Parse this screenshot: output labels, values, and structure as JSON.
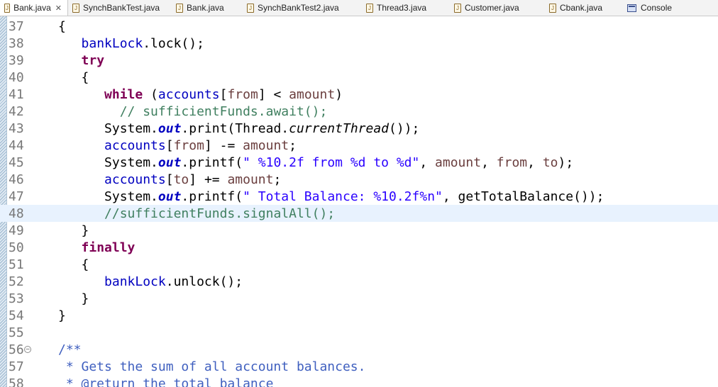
{
  "tabs": [
    {
      "label": "Bank.java",
      "type": "java",
      "active": true,
      "closable": true
    },
    {
      "label": "SynchBankTest.java",
      "type": "java"
    },
    {
      "label": "Bank.java",
      "type": "java"
    },
    {
      "label": "SynchBankTest2.java",
      "type": "java"
    },
    {
      "label": "Thread3.java",
      "type": "java"
    },
    {
      "label": "Customer.java",
      "type": "java"
    },
    {
      "label": "Cbank.java",
      "type": "java"
    },
    {
      "label": "Console",
      "type": "console"
    }
  ],
  "icons": {
    "java_file": "java-file-icon",
    "console": "console-icon",
    "close": "close-icon",
    "fold": "fold-toggle-icon"
  },
  "colors": {
    "keyword": "#7f0055",
    "field": "#0000c0",
    "string": "#2a00ff",
    "comment": "#3f7f5f",
    "javadoc": "#3f5fbf",
    "current_line": "#e8f2fe"
  },
  "editor": {
    "current_line": 48,
    "lines": [
      {
        "num": "37",
        "indent": "",
        "tokens": [
          {
            "t": "{",
            "c": ""
          }
        ]
      },
      {
        "num": "38",
        "indent": "   ",
        "tokens": [
          {
            "t": "bankLock",
            "c": "fld"
          },
          {
            "t": ".lock();",
            "c": ""
          }
        ]
      },
      {
        "num": "39",
        "indent": "   ",
        "tokens": [
          {
            "t": "try",
            "c": "kw"
          }
        ]
      },
      {
        "num": "40",
        "indent": "   ",
        "tokens": [
          {
            "t": "{",
            "c": ""
          }
        ]
      },
      {
        "num": "41",
        "indent": "      ",
        "tokens": [
          {
            "t": "while",
            "c": "kw"
          },
          {
            "t": " (",
            "c": ""
          },
          {
            "t": "accounts",
            "c": "fld"
          },
          {
            "t": "[",
            "c": ""
          },
          {
            "t": "from",
            "c": "var"
          },
          {
            "t": "] < ",
            "c": ""
          },
          {
            "t": "amount",
            "c": "var"
          },
          {
            "t": ")",
            "c": ""
          }
        ]
      },
      {
        "num": "42",
        "indent": "        ",
        "tokens": [
          {
            "t": "// sufficientFunds.await();",
            "c": "cmt"
          }
        ]
      },
      {
        "num": "43",
        "indent": "      ",
        "tokens": [
          {
            "t": "System.",
            "c": ""
          },
          {
            "t": "out",
            "c": "sfld"
          },
          {
            "t": ".print(Thread.",
            "c": ""
          },
          {
            "t": "currentThread",
            "c": "smeth"
          },
          {
            "t": "());",
            "c": ""
          }
        ]
      },
      {
        "num": "44",
        "indent": "      ",
        "tokens": [
          {
            "t": "accounts",
            "c": "fld"
          },
          {
            "t": "[",
            "c": ""
          },
          {
            "t": "from",
            "c": "var"
          },
          {
            "t": "] -= ",
            "c": ""
          },
          {
            "t": "amount",
            "c": "var"
          },
          {
            "t": ";",
            "c": ""
          }
        ]
      },
      {
        "num": "45",
        "indent": "      ",
        "tokens": [
          {
            "t": "System.",
            "c": ""
          },
          {
            "t": "out",
            "c": "sfld"
          },
          {
            "t": ".printf(",
            "c": ""
          },
          {
            "t": "\" %10.2f from %d to %d\"",
            "c": "str"
          },
          {
            "t": ", ",
            "c": ""
          },
          {
            "t": "amount",
            "c": "var"
          },
          {
            "t": ", ",
            "c": ""
          },
          {
            "t": "from",
            "c": "var"
          },
          {
            "t": ", ",
            "c": ""
          },
          {
            "t": "to",
            "c": "var"
          },
          {
            "t": ");",
            "c": ""
          }
        ]
      },
      {
        "num": "46",
        "indent": "      ",
        "tokens": [
          {
            "t": "accounts",
            "c": "fld"
          },
          {
            "t": "[",
            "c": ""
          },
          {
            "t": "to",
            "c": "var"
          },
          {
            "t": "] += ",
            "c": ""
          },
          {
            "t": "amount",
            "c": "var"
          },
          {
            "t": ";",
            "c": ""
          }
        ]
      },
      {
        "num": "47",
        "indent": "      ",
        "tokens": [
          {
            "t": "System.",
            "c": ""
          },
          {
            "t": "out",
            "c": "sfld"
          },
          {
            "t": ".printf(",
            "c": ""
          },
          {
            "t": "\" Total Balance: %10.2f%n\"",
            "c": "str"
          },
          {
            "t": ", getTotalBalance());",
            "c": ""
          }
        ]
      },
      {
        "num": "48",
        "indent": "      ",
        "tokens": [
          {
            "t": "//sufficientFunds.signalAll();",
            "c": "cmt"
          }
        ]
      },
      {
        "num": "49",
        "indent": "   ",
        "tokens": [
          {
            "t": "}",
            "c": ""
          }
        ]
      },
      {
        "num": "50",
        "indent": "   ",
        "tokens": [
          {
            "t": "finally",
            "c": "kw"
          }
        ]
      },
      {
        "num": "51",
        "indent": "   ",
        "tokens": [
          {
            "t": "{",
            "c": ""
          }
        ]
      },
      {
        "num": "52",
        "indent": "      ",
        "tokens": [
          {
            "t": "bankLock",
            "c": "fld"
          },
          {
            "t": ".unlock();",
            "c": ""
          }
        ]
      },
      {
        "num": "53",
        "indent": "   ",
        "tokens": [
          {
            "t": "}",
            "c": ""
          }
        ]
      },
      {
        "num": "54",
        "indent": "",
        "tokens": [
          {
            "t": "}",
            "c": ""
          }
        ]
      },
      {
        "num": "55",
        "indent": "",
        "tokens": []
      },
      {
        "num": "56",
        "indent": "",
        "fold": "−",
        "tokens": [
          {
            "t": "/**",
            "c": "jdoc"
          }
        ]
      },
      {
        "num": "57",
        "indent": "",
        "tokens": [
          {
            "t": " * Gets the sum of all account balances.",
            "c": "jdoc"
          }
        ]
      },
      {
        "num": "58",
        "indent": "",
        "tokens": [
          {
            "t": " * @return the total balance",
            "c": "jdoc"
          }
        ]
      }
    ]
  }
}
